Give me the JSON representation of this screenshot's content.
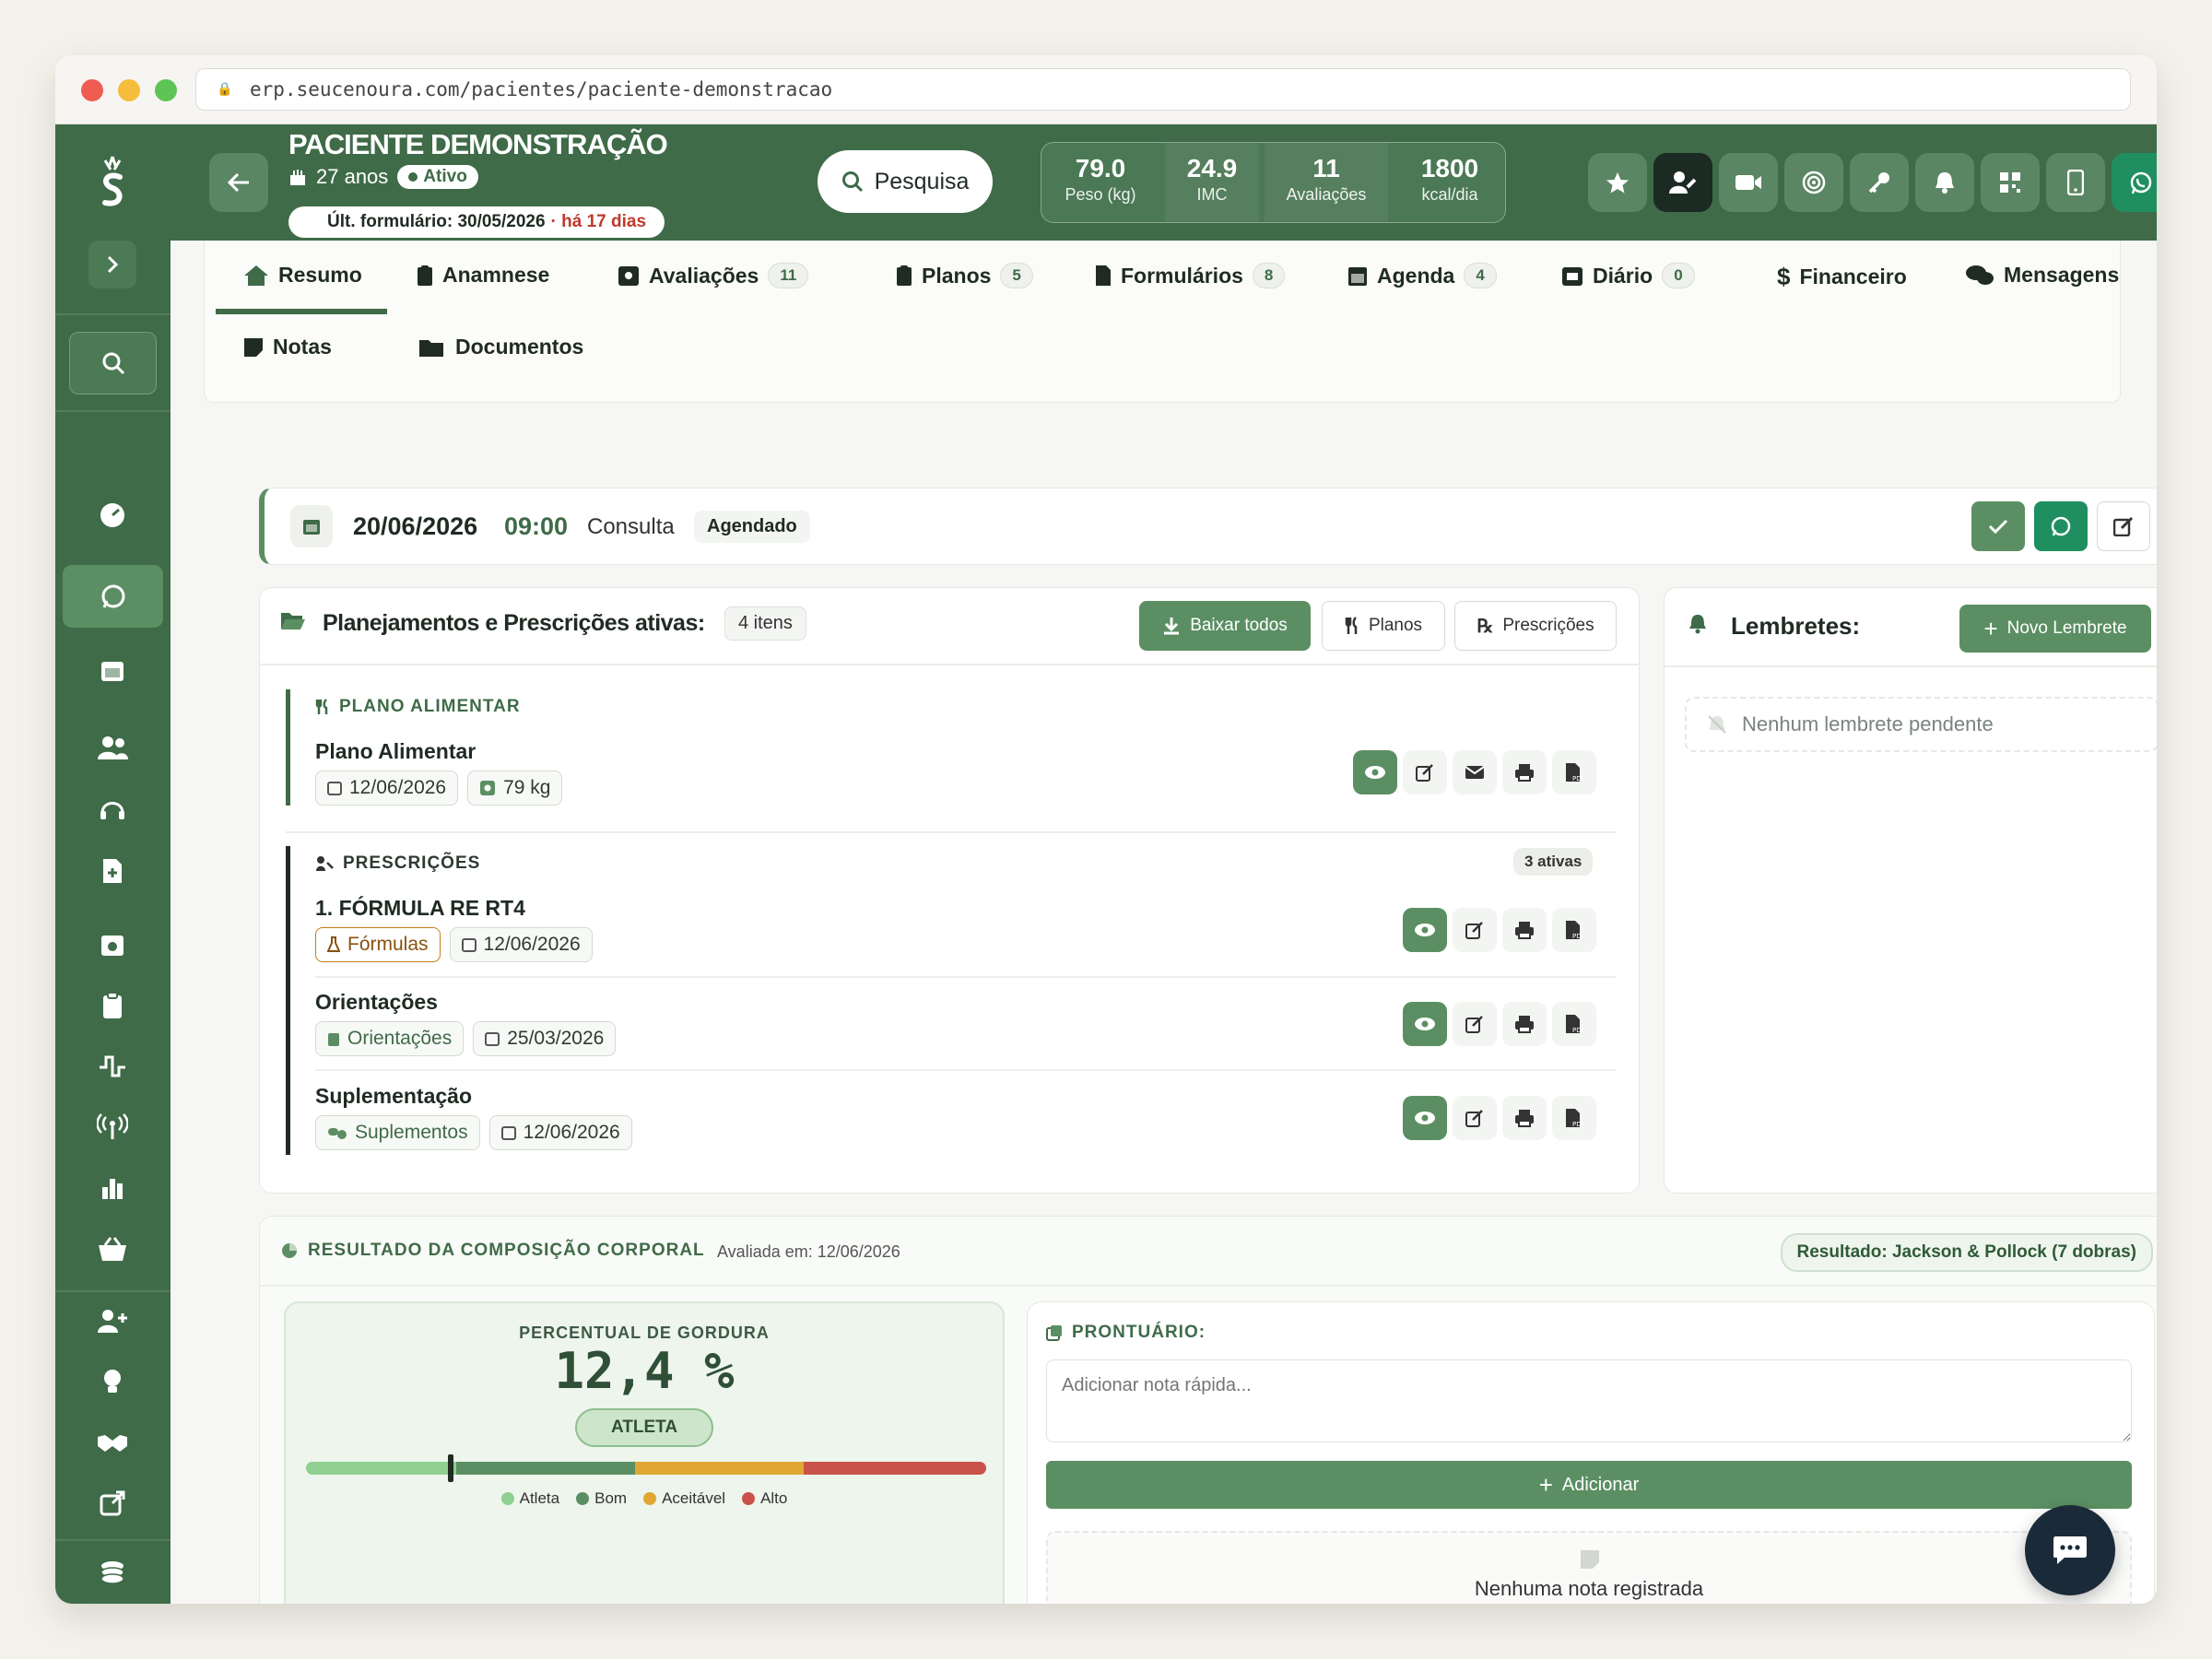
{
  "browser": {
    "url": "erp.seucenoura.com/pacientes/paciente-demonstracao"
  },
  "patient": {
    "name": "PACIENTE DEMONSTRAÇÃO",
    "age": "27 anos",
    "status": "Ativo",
    "last_form_label": "Últ. formulário: 30/05/2026",
    "last_form_ago": "· há 17 dias"
  },
  "search": {
    "label": "Pesquisa"
  },
  "stats": [
    {
      "value": "79.0",
      "label": "Peso (kg)"
    },
    {
      "value": "24.9",
      "label": "IMC"
    },
    {
      "value": "11",
      "label": "Avaliações"
    },
    {
      "value": "1800",
      "label": "kcal/dia"
    }
  ],
  "tabs": [
    {
      "label": "Resumo",
      "badge": ""
    },
    {
      "label": "Anamnese",
      "badge": ""
    },
    {
      "label": "Avaliações",
      "badge": "11"
    },
    {
      "label": "Planos",
      "badge": "5"
    },
    {
      "label": "Formulários",
      "badge": "8"
    },
    {
      "label": "Agenda",
      "badge": "4"
    },
    {
      "label": "Diário",
      "badge": "0"
    },
    {
      "label": "Financeiro",
      "badge": ""
    },
    {
      "label": "Mensagens",
      "badge": ""
    },
    {
      "label": "Notas",
      "badge": ""
    },
    {
      "label": "Documentos",
      "badge": ""
    }
  ],
  "appointment": {
    "date": "20/06/2026",
    "time": "09:00",
    "type": "Consulta",
    "status": "Agendado"
  },
  "plans": {
    "title": "Planejamentos e Prescrições ativas:",
    "count": "4 itens",
    "download_all": "Baixar todos",
    "planos_btn": "Planos",
    "prescricoes_btn": "Prescrições",
    "meal_section": "PLANO ALIMENTAR",
    "meal_title": "Plano Alimentar",
    "meal_date": "12/06/2026",
    "meal_weight": "79 kg",
    "presc_section": "PRESCRIÇÕES",
    "presc_active": "3 ativas",
    "prescriptions": [
      {
        "title": "1. FÓRMULA RE RT4",
        "tag": "Fórmulas",
        "date": "12/06/2026"
      },
      {
        "title": "Orientações",
        "tag": "Orientações",
        "date": "25/03/2026"
      },
      {
        "title": "Suplementação",
        "tag": "Suplementos",
        "date": "12/06/2026"
      }
    ]
  },
  "reminders": {
    "title": "Lembretes:",
    "new_btn": "Novo Lembrete",
    "empty": "Nenhum lembrete pendente"
  },
  "composition": {
    "title": "RESULTADO DA COMPOSIÇÃO CORPORAL",
    "evaluated": "Avaliada em: 12/06/2026",
    "result": "Resultado: Jackson & Pollock (7 dobras)",
    "fat_label": "PERCENTUAL DE GORDURA",
    "fat_value": "12,4 %",
    "fat_value_num": 12.4,
    "classification": "ATLETA",
    "legend": [
      {
        "name": "Atleta",
        "color": "#8fcf8f"
      },
      {
        "name": "Bom",
        "color": "#5b8f63"
      },
      {
        "name": "Aceitável",
        "color": "#e0a832"
      },
      {
        "name": "Alto",
        "color": "#c9534a"
      }
    ]
  },
  "notes": {
    "title": "PRONTUÁRIO:",
    "placeholder": "Adicionar nota rápida...",
    "add_btn": "Adicionar",
    "empty": "Nenhuma nota registrada"
  },
  "colors": {
    "brand": "#3f6b48",
    "accent": "#5b8f63",
    "whatsapp": "#1f8f5f",
    "danger": "#c0392b"
  }
}
